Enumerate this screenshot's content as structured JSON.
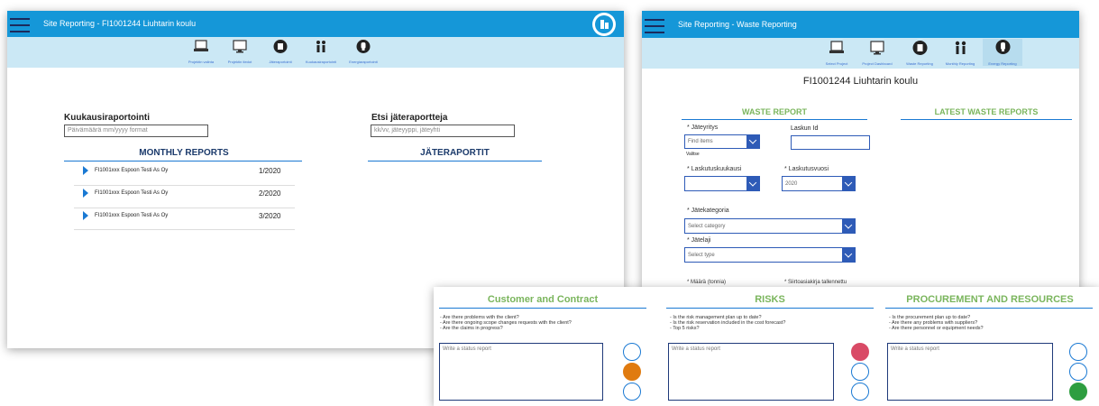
{
  "reports_window": {
    "title": "Site Reporting - FI1001244 Liuhtarin koulu",
    "nav": [
      {
        "label": "Projektin valinta",
        "icon": "laptop-icon"
      },
      {
        "label": "Projektin tiedot",
        "icon": "monitor-icon"
      },
      {
        "label": "Jäteraportointi",
        "icon": "bin-icon"
      },
      {
        "label": "Kuukausiraportointi",
        "icon": "people-icon"
      },
      {
        "label": "Energiaraportointi",
        "icon": "bulb-icon"
      }
    ],
    "monthly_label": "Kuukausiraportointi",
    "monthly_placeholder": "Päivämäärä mm/yyyy format",
    "waste_search_label": "Etsi jäteraportteja",
    "waste_search_placeholder": "kk/vv, jäteyyppi, jäteyhti",
    "monthly_title": "MONTHLY REPORTS",
    "waste_title": "JÄTERAPORTIT",
    "rows": [
      {
        "name": "FI1001xxx Espoon Testi As Oy",
        "date": "1/2020"
      },
      {
        "name": "FI1001xxx Espoon Testi As Oy",
        "date": "2/2020"
      },
      {
        "name": "FI1001xxx Espoon Testi As Oy",
        "date": "3/2020"
      }
    ]
  },
  "waste_window": {
    "title": "Site Reporting - Waste Reporting",
    "nav": [
      {
        "label": "Select Project",
        "icon": "laptop-icon"
      },
      {
        "label": "Project Dashboard",
        "icon": "monitor-icon"
      },
      {
        "label": "Waste Reporting",
        "icon": "bin-icon"
      },
      {
        "label": "Monthly Reporting",
        "icon": "people-icon"
      },
      {
        "label": "Energy Reporting",
        "icon": "bulb-icon"
      }
    ],
    "project_name": "FI1001244 Liuhtarin koulu",
    "waste_report_title": "WASTE REPORT",
    "latest_title": "LATEST WASTE REPORTS",
    "jateyritys_label": "Jäteyritys",
    "jateyritys_placeholder": "Find items",
    "valitse": "Valitse",
    "laskun_id_label": "Laskun Id",
    "laskutuskuukausi_label": "Laskutuskuukausi",
    "laskutusvuosi_label": "Laskutusvuosi",
    "laskutusvuosi_value": "2020",
    "jatekategoria_label": "Jätekategoria",
    "category_placeholder": "Select category",
    "jatelaji_label": "Jätelaji",
    "type_placeholder": "Select type",
    "maara_label": "Määrä (tonnia)",
    "siirto_label": "Siirtoasiakirja tallennettu"
  },
  "status_panel": {
    "columns": [
      {
        "title": "Customer and Contract",
        "questions": [
          "- Are there problems with the client?",
          "- Are there ongoing scope changes requests with the client?",
          "- Are the claims in progress?"
        ],
        "placeholder": "Write a status report",
        "selected": "orange"
      },
      {
        "title": "RISKS",
        "questions": [
          "- Is the risk management plan up to date?",
          "- Is the risk reservation included in the cost forecast?",
          "- Top 5 risks?"
        ],
        "placeholder": "Write a status report",
        "selected": "red"
      },
      {
        "title": "PROCUREMENT AND RESOURCES",
        "questions": [
          "- Is the procurement plan up to date?",
          "- Are there any problems with suppliers?",
          "- Are there personnel or equipment needs?"
        ],
        "placeholder": "Write a status report",
        "selected": "green"
      }
    ],
    "colors": {
      "red": "#d94a66",
      "orange": "#e07b10",
      "green": "#2e9e40",
      "outline": "#1a79d3",
      "title": "#7ab55c"
    }
  }
}
